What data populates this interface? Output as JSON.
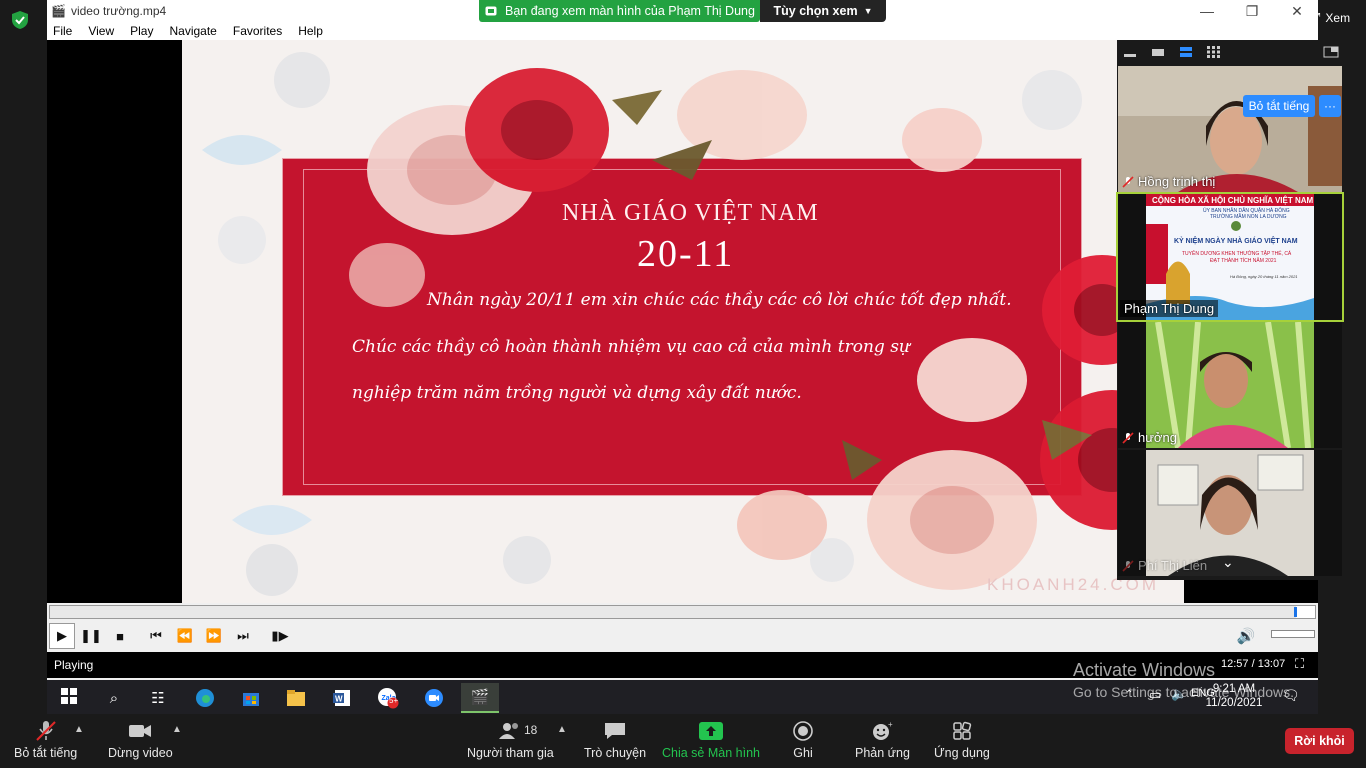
{
  "zoom_top": {
    "share_banner": "Bạn đang xem màn hình của Phạm Thị Dung",
    "view_options": "Tùy chọn xem",
    "view_button": "Xem"
  },
  "player": {
    "title": "video trường.mp4",
    "menu": [
      "File",
      "View",
      "Play",
      "Navigate",
      "Favorites",
      "Help"
    ],
    "card": {
      "title": "NHÀ GIÁO VIỆT NAM",
      "date": "20-11",
      "line1": "Nhân ngày 20/11 em xin chúc các thầy các cô lời chúc tốt đẹp nhất.",
      "line2": "Chúc các thầy cô hoàn thành nhiệm vụ cao cả của mình trong sự",
      "line3": "nghiệp trăm năm trồng người và dựng xây đất nước.",
      "watermark": "KHOANH24.COM"
    },
    "seek_progress": 0.985,
    "status": "Playing",
    "time": "12:57 / 13:07"
  },
  "gallery": {
    "unmute_all": "Bỏ tắt tiếng",
    "more": "···",
    "participants": [
      {
        "name": "Hồng trịnh thị",
        "muted": true
      },
      {
        "name": "Phạm Thị Dung",
        "muted": false
      },
      {
        "name": "hưởng",
        "muted": true
      },
      {
        "name": "Phí Thị Liên",
        "muted": true
      }
    ],
    "shared_slide": {
      "line1": "CỘNG HÒA XÃ HỘI CHỦ NGHĨA VIỆT NAM",
      "line2": "ỦY BAN NHÂN DÂN QUẬN HÀ ĐÔNG",
      "line3": "TRƯỜNG MẦM NON LA DƯƠNG",
      "line4": "KỶ NIỆM NGÀY NHÀ GIÁO VIỆT NAM",
      "line5": "TUYÊN DƯƠNG KHEN THƯỞNG TẬP THỂ, CÁ",
      "line6": "ĐẠT THÀNH TÍCH NĂM 2021",
      "line7": "Hà Đông, ngày 20 tháng 11 năm 2021"
    }
  },
  "taskbar": {
    "time": "9:21 AM",
    "date": "11/20/2021",
    "zalo_badge": "5+"
  },
  "activate": {
    "line1": "Activate Windows",
    "line2": "Go to Settings to activate Windows."
  },
  "toolbar": {
    "mute": "Bỏ tắt tiếng",
    "stop_video": "Dừng video",
    "participants": "Người tham gia",
    "participant_count": "18",
    "chat": "Trò chuyện",
    "share_screen": "Chia sẻ Màn hình",
    "record": "Ghi",
    "reactions": "Phản ứng",
    "apps": "Ứng dụng",
    "leave": "Rời khỏi"
  },
  "colors": {
    "zoom_green": "#23a241",
    "zoom_blue": "#2d8cff",
    "leave_red": "#c8232c",
    "card_red": "#c4142e"
  }
}
